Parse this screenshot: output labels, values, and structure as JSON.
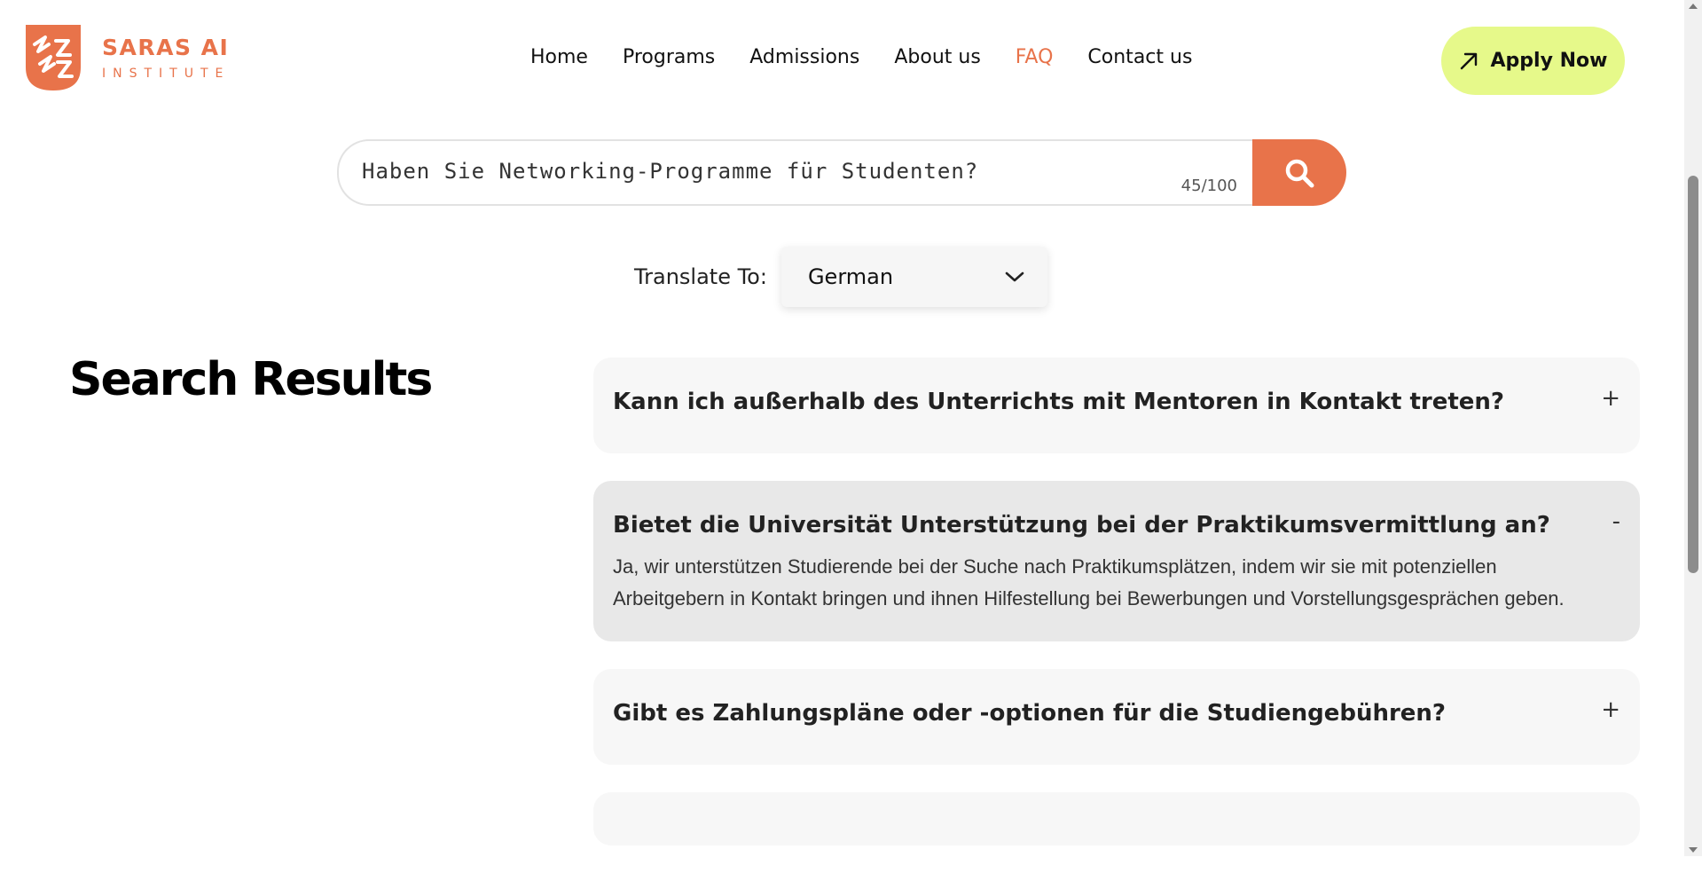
{
  "brand": {
    "title": "SARAS AI",
    "subtitle": "INSTITUTE",
    "accent_color": "#e8734a",
    "logo_icon": "saras-logo-icon"
  },
  "nav": {
    "items": [
      {
        "label": "Home",
        "active": false
      },
      {
        "label": "Programs",
        "active": false
      },
      {
        "label": "Admissions",
        "active": false
      },
      {
        "label": "About us",
        "active": false
      },
      {
        "label": "FAQ",
        "active": true
      },
      {
        "label": "Contact us",
        "active": false
      }
    ],
    "apply_label": "Apply Now",
    "apply_icon": "arrow-up-right-icon",
    "apply_color": "#e6f98a"
  },
  "search": {
    "value": "Haben Sie Networking-Programme für Studenten?",
    "char_count": "45/100",
    "button_icon": "search-icon"
  },
  "translate": {
    "label": "Translate To:",
    "selected": "German",
    "icon": "chevron-down-icon"
  },
  "results": {
    "title": "Search Results",
    "items": [
      {
        "question": "Kann ich außerhalb des Unterrichts mit Mentoren in Kontakt treten?",
        "toggle": "+",
        "expanded": false
      },
      {
        "question": "Bietet die Universität Unterstützung bei der Praktikumsvermittlung an?",
        "toggle": "-",
        "expanded": true,
        "answer": "Ja, wir unterstützen Studierende bei der Suche nach Praktikumsplätzen, indem wir sie mit potenziellen Arbeitgebern in Kontakt bringen und ihnen Hilfestellung bei Bewerbungen und Vorstellungsgesprächen geben."
      },
      {
        "question": "Gibt es Zahlungspläne oder -optionen für die Studiengebühren?",
        "toggle": "+",
        "expanded": false
      }
    ]
  }
}
